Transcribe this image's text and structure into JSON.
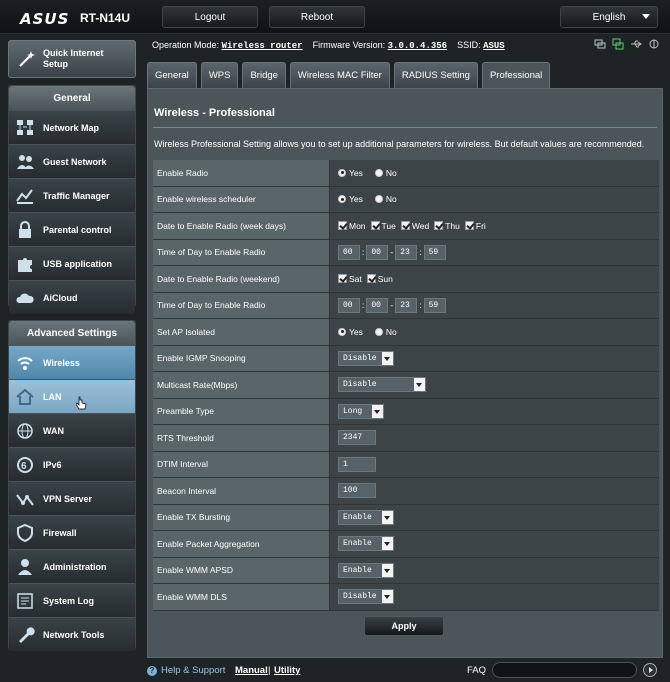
{
  "header": {
    "brand": "ASUS",
    "model": "RT-N14U",
    "logout_label": "Logout",
    "reboot_label": "Reboot",
    "language": "English"
  },
  "status": {
    "op_mode_label": "Operation Mode:",
    "op_mode_value": "Wireless router",
    "firmware_label": "Firmware Version:",
    "firmware_value": "3.0.0.4.356",
    "ssid_label": "SSID:",
    "ssid_value": "ASUS"
  },
  "quick_setup": {
    "line1": "Quick Internet",
    "line2": "Setup"
  },
  "nav_general": {
    "title": "General",
    "items": [
      {
        "label": "Network Map",
        "icon": "network-map-icon"
      },
      {
        "label": "Guest Network",
        "icon": "guest-network-icon"
      },
      {
        "label": "Traffic Manager",
        "icon": "traffic-manager-icon"
      },
      {
        "label": "Parental control",
        "icon": "lock-icon"
      },
      {
        "label": "USB application",
        "icon": "puzzle-icon"
      },
      {
        "label": "AiCloud",
        "icon": "cloud-icon"
      }
    ]
  },
  "nav_advanced": {
    "title": "Advanced Settings",
    "items": [
      {
        "label": "Wireless",
        "icon": "wifi-icon"
      },
      {
        "label": "LAN",
        "icon": "home-icon"
      },
      {
        "label": "WAN",
        "icon": "globe-icon"
      },
      {
        "label": "IPv6",
        "icon": "ipv6-icon"
      },
      {
        "label": "VPN Server",
        "icon": "vpn-icon"
      },
      {
        "label": "Firewall",
        "icon": "shield-icon"
      },
      {
        "label": "Administration",
        "icon": "user-icon"
      },
      {
        "label": "System Log",
        "icon": "log-icon"
      },
      {
        "label": "Network Tools",
        "icon": "wrench-icon"
      }
    ]
  },
  "tabs": [
    "General",
    "WPS",
    "Bridge",
    "Wireless MAC Filter",
    "RADIUS Setting",
    "Professional"
  ],
  "panel": {
    "title": "Wireless - Professional",
    "description": "Wireless Professional Setting allows you to set up additional parameters for wireless. But default values are recommended."
  },
  "settings": {
    "enable_radio": {
      "label": "Enable Radio",
      "yes": "Yes",
      "no": "No"
    },
    "wireless_scheduler": {
      "label": "Enable wireless scheduler",
      "yes": "Yes",
      "no": "No"
    },
    "weekdays": {
      "label": "Date to Enable Radio (week days)",
      "days": [
        "Mon",
        "Tue",
        "Wed",
        "Thu",
        "Fri"
      ]
    },
    "time_weekdays": {
      "label": "Time of Day to Enable Radio",
      "h1": "00",
      "m1": "00",
      "h2": "23",
      "m2": "59",
      "sep": "-"
    },
    "weekend": {
      "label": "Date to Enable Radio (weekend)",
      "days": [
        "Sat",
        "Sun"
      ]
    },
    "time_weekend": {
      "label": "Time of Day to Enable Radio",
      "h1": "00",
      "m1": "00",
      "h2": "23",
      "m2": "59",
      "sep": "-"
    },
    "ap_isolated": {
      "label": "Set AP Isolated",
      "yes": "Yes",
      "no": "No"
    },
    "igmp": {
      "label": "Enable IGMP Snooping",
      "value": "Disable"
    },
    "multicast": {
      "label": "Multicast Rate(Mbps)",
      "value": "Disable"
    },
    "preamble": {
      "label": "Preamble Type",
      "value": "Long"
    },
    "rts": {
      "label": "RTS Threshold",
      "value": "2347"
    },
    "dtim": {
      "label": "DTIM Interval",
      "value": "1"
    },
    "beacon": {
      "label": "Beacon Interval",
      "value": "100"
    },
    "tx_burst": {
      "label": "Enable TX Bursting",
      "value": "Enable"
    },
    "pkt_agg": {
      "label": "Enable Packet Aggregation",
      "value": "Enable"
    },
    "wmm_apsd": {
      "label": "Enable WMM APSD",
      "value": "Enable"
    },
    "wmm_dls": {
      "label": "Enable WMM DLS",
      "value": "Disable"
    }
  },
  "apply_label": "Apply",
  "footer": {
    "help": "Help & Support",
    "manual": "Manual",
    "sep": "|",
    "utility": "Utility",
    "faq": "FAQ"
  },
  "colors": {
    "accent": "#76a9c8",
    "panel": "#4b555a",
    "background": "#1e2326"
  }
}
